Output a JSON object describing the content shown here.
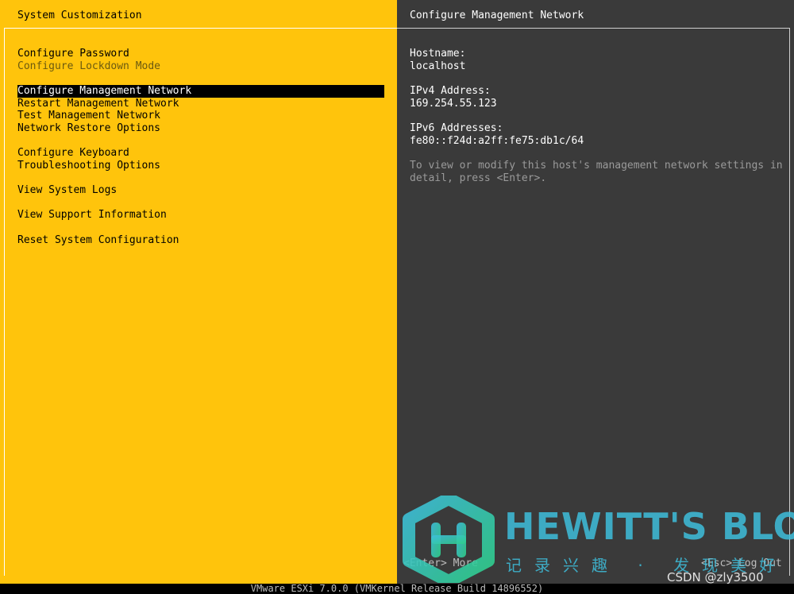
{
  "left": {
    "title": "System Customization",
    "menu": [
      {
        "label": "Configure Password",
        "state": "normal"
      },
      {
        "label": "Configure Lockdown Mode",
        "state": "disabled"
      },
      {
        "label": "Configure Management Network",
        "state": "selected"
      },
      {
        "label": "Restart Management Network",
        "state": "normal"
      },
      {
        "label": "Test Management Network",
        "state": "normal"
      },
      {
        "label": "Network Restore Options",
        "state": "normal"
      },
      {
        "label": "Configure Keyboard",
        "state": "normal"
      },
      {
        "label": "Troubleshooting Options",
        "state": "normal"
      },
      {
        "label": "View System Logs",
        "state": "normal"
      },
      {
        "label": "View Support Information",
        "state": "normal"
      },
      {
        "label": "Reset System Configuration",
        "state": "normal"
      }
    ]
  },
  "right": {
    "title": "Configure Management Network",
    "hostname_label": "Hostname:",
    "hostname_value": "localhost",
    "ipv4_label": "IPv4 Address:",
    "ipv4_value": "169.254.55.123",
    "ipv6_label": "IPv6 Addresses:",
    "ipv6_value": "fe80::f24d:a2ff:fe75:db1c/64",
    "description": "To view or modify this host's management network settings in detail, press <Enter>.",
    "hint_left": "<Enter> More",
    "hint_right": "<Esc> Log Out"
  },
  "status_bar": "VMware ESXi 7.0.0 (VMKernel Release Build 14896552)",
  "watermark": {
    "title": "HEWITT'S BLOG",
    "subtitle": "记录兴趣 · 发现美好",
    "csdn": "CSDN @zly3500"
  },
  "colors": {
    "left_bg": "#ffc40c",
    "right_bg": "#3a3a3a",
    "selected_bg": "#000000",
    "watermark": "#3ebedc"
  }
}
